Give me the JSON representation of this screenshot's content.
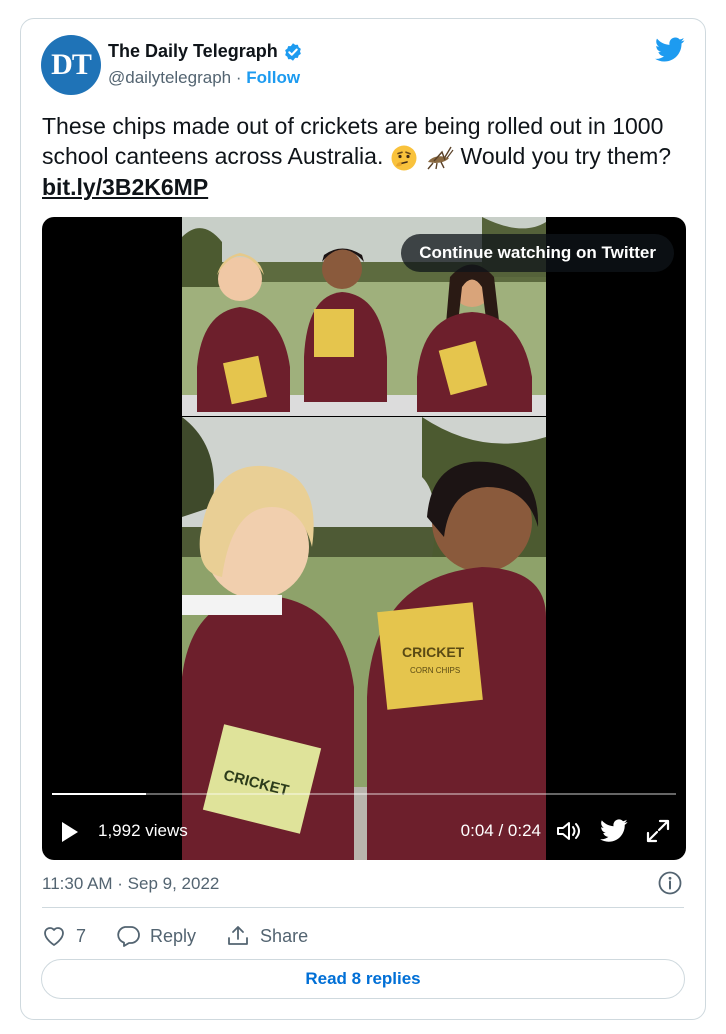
{
  "author": {
    "avatar_initials": "DT",
    "display_name": "The Daily Telegraph",
    "handle": "@dailytelegraph",
    "separator": "·",
    "follow_label": "Follow",
    "verified_icon": "verified-badge-icon"
  },
  "tweet": {
    "text_before_link": "These chips made out of crickets are being rolled out in 1000 school canteens across Australia.",
    "text_after_emoji": " Would you try them?",
    "emojis": [
      "thinking-face-emoji",
      "cricket-emoji"
    ],
    "link_text": "bit.ly/3B2K6MP"
  },
  "video": {
    "continue_label": "Continue watching on Twitter",
    "views": "1,992 views",
    "time": "0:04 / 0:24",
    "progress_fraction": 0.15,
    "chip_brand": "CRICKET",
    "chip_sub": "CORN CHIPS"
  },
  "meta": {
    "timestamp": "11:30 AM · Sep 9, 2022"
  },
  "actions": {
    "like_count": "7",
    "reply_label": "Reply",
    "share_label": "Share"
  },
  "footer": {
    "read_replies_label": "Read 8 replies"
  },
  "colors": {
    "twitter_blue": "#1d9bf0",
    "link_blue": "#006fd6",
    "avatar_blue": "#1f73b7",
    "text_secondary": "#536471",
    "border": "#cfd9de"
  }
}
